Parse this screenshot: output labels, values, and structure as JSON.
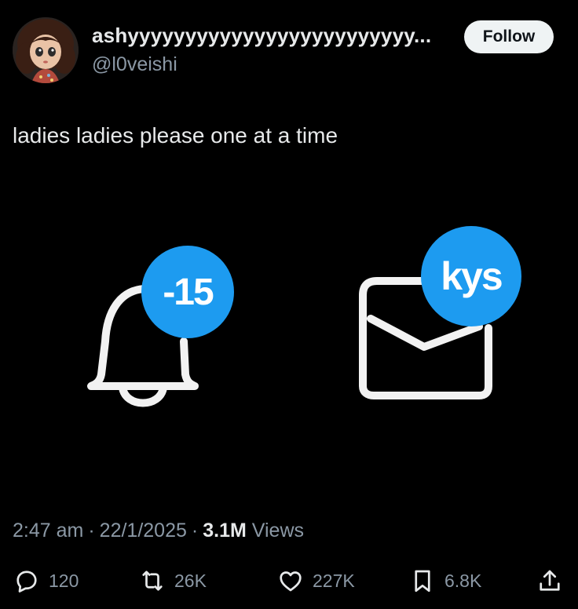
{
  "author": {
    "display_name": "ashyyyyyyyyyyyyyyyyyyyyyyyyy...",
    "handle": "@l0veishi"
  },
  "follow_label": "Follow",
  "post": {
    "text": "ladies ladies please one at a time",
    "notification_badge": "-15",
    "message_badge": "kys"
  },
  "meta": {
    "time": "2:47 am",
    "date": "22/1/2025",
    "views_count": "3.1M",
    "views_label": "Views"
  },
  "actions": {
    "replies": "120",
    "reposts": "26K",
    "likes": "227K",
    "bookmarks": "6.8K"
  },
  "colors": {
    "background": "#000000",
    "accent_blue": "#1d9bf0",
    "text_primary": "#e7e9ea",
    "text_secondary": "#8b98a5",
    "follow_button_bg": "#eff3f4"
  },
  "icons": [
    "bell-icon",
    "envelope-icon",
    "reply-icon",
    "repost-icon",
    "heart-icon",
    "bookmark-icon",
    "share-icon"
  ]
}
